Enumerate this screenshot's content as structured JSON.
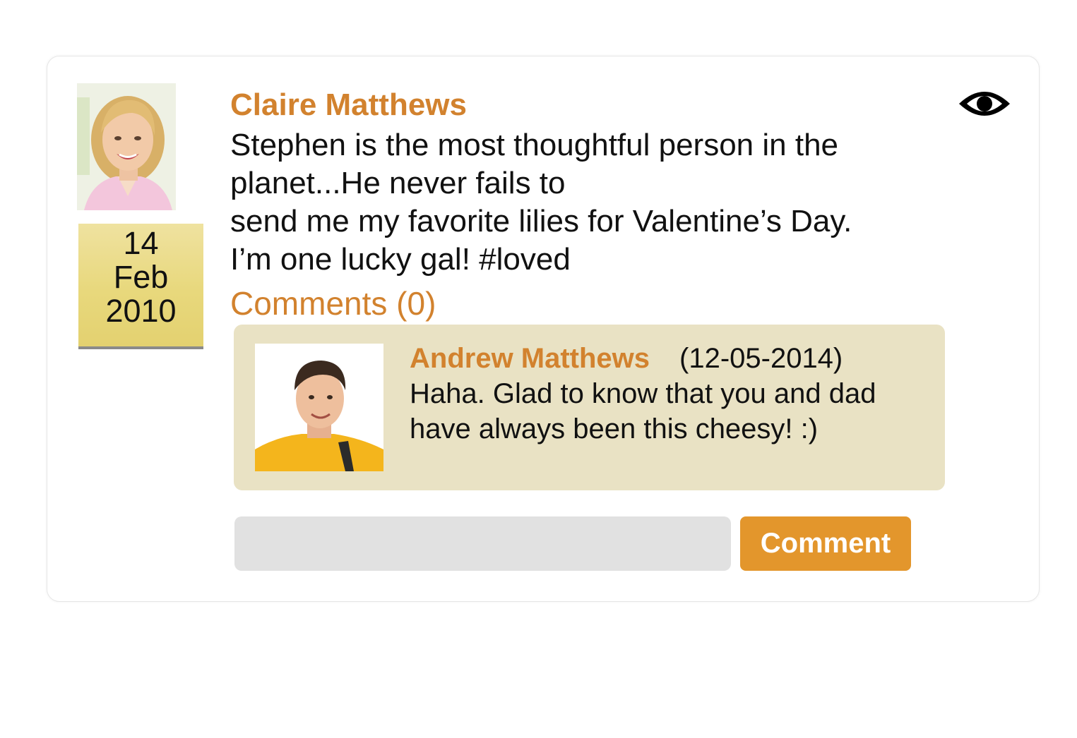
{
  "post": {
    "author": "Claire Matthews",
    "date": {
      "day": "14",
      "month": "Feb",
      "year": "2010"
    },
    "text_lines": [
      "Stephen is the most thoughtful person in the",
      "planet...He never fails to",
      "send me my favorite lilies for Valentine’s Day.",
      "I’m one lucky gal! #loved"
    ],
    "comments_label": "Comments (0)",
    "visibility_icon": "eye-icon"
  },
  "comment": {
    "author": "Andrew Matthews",
    "date": "(12-05-2014)",
    "text_lines": [
      "Haha. Glad to know that you and dad",
      "have always been this cheesy! :)"
    ]
  },
  "composer": {
    "input_value": "",
    "input_placeholder": "",
    "button_label": "Comment"
  },
  "colors": {
    "accent": "#d2822e",
    "button": "#e3962c",
    "comment_bg": "#e9e2c4",
    "date_note": "#e8d87c",
    "input_bg": "#e1e1e1"
  }
}
